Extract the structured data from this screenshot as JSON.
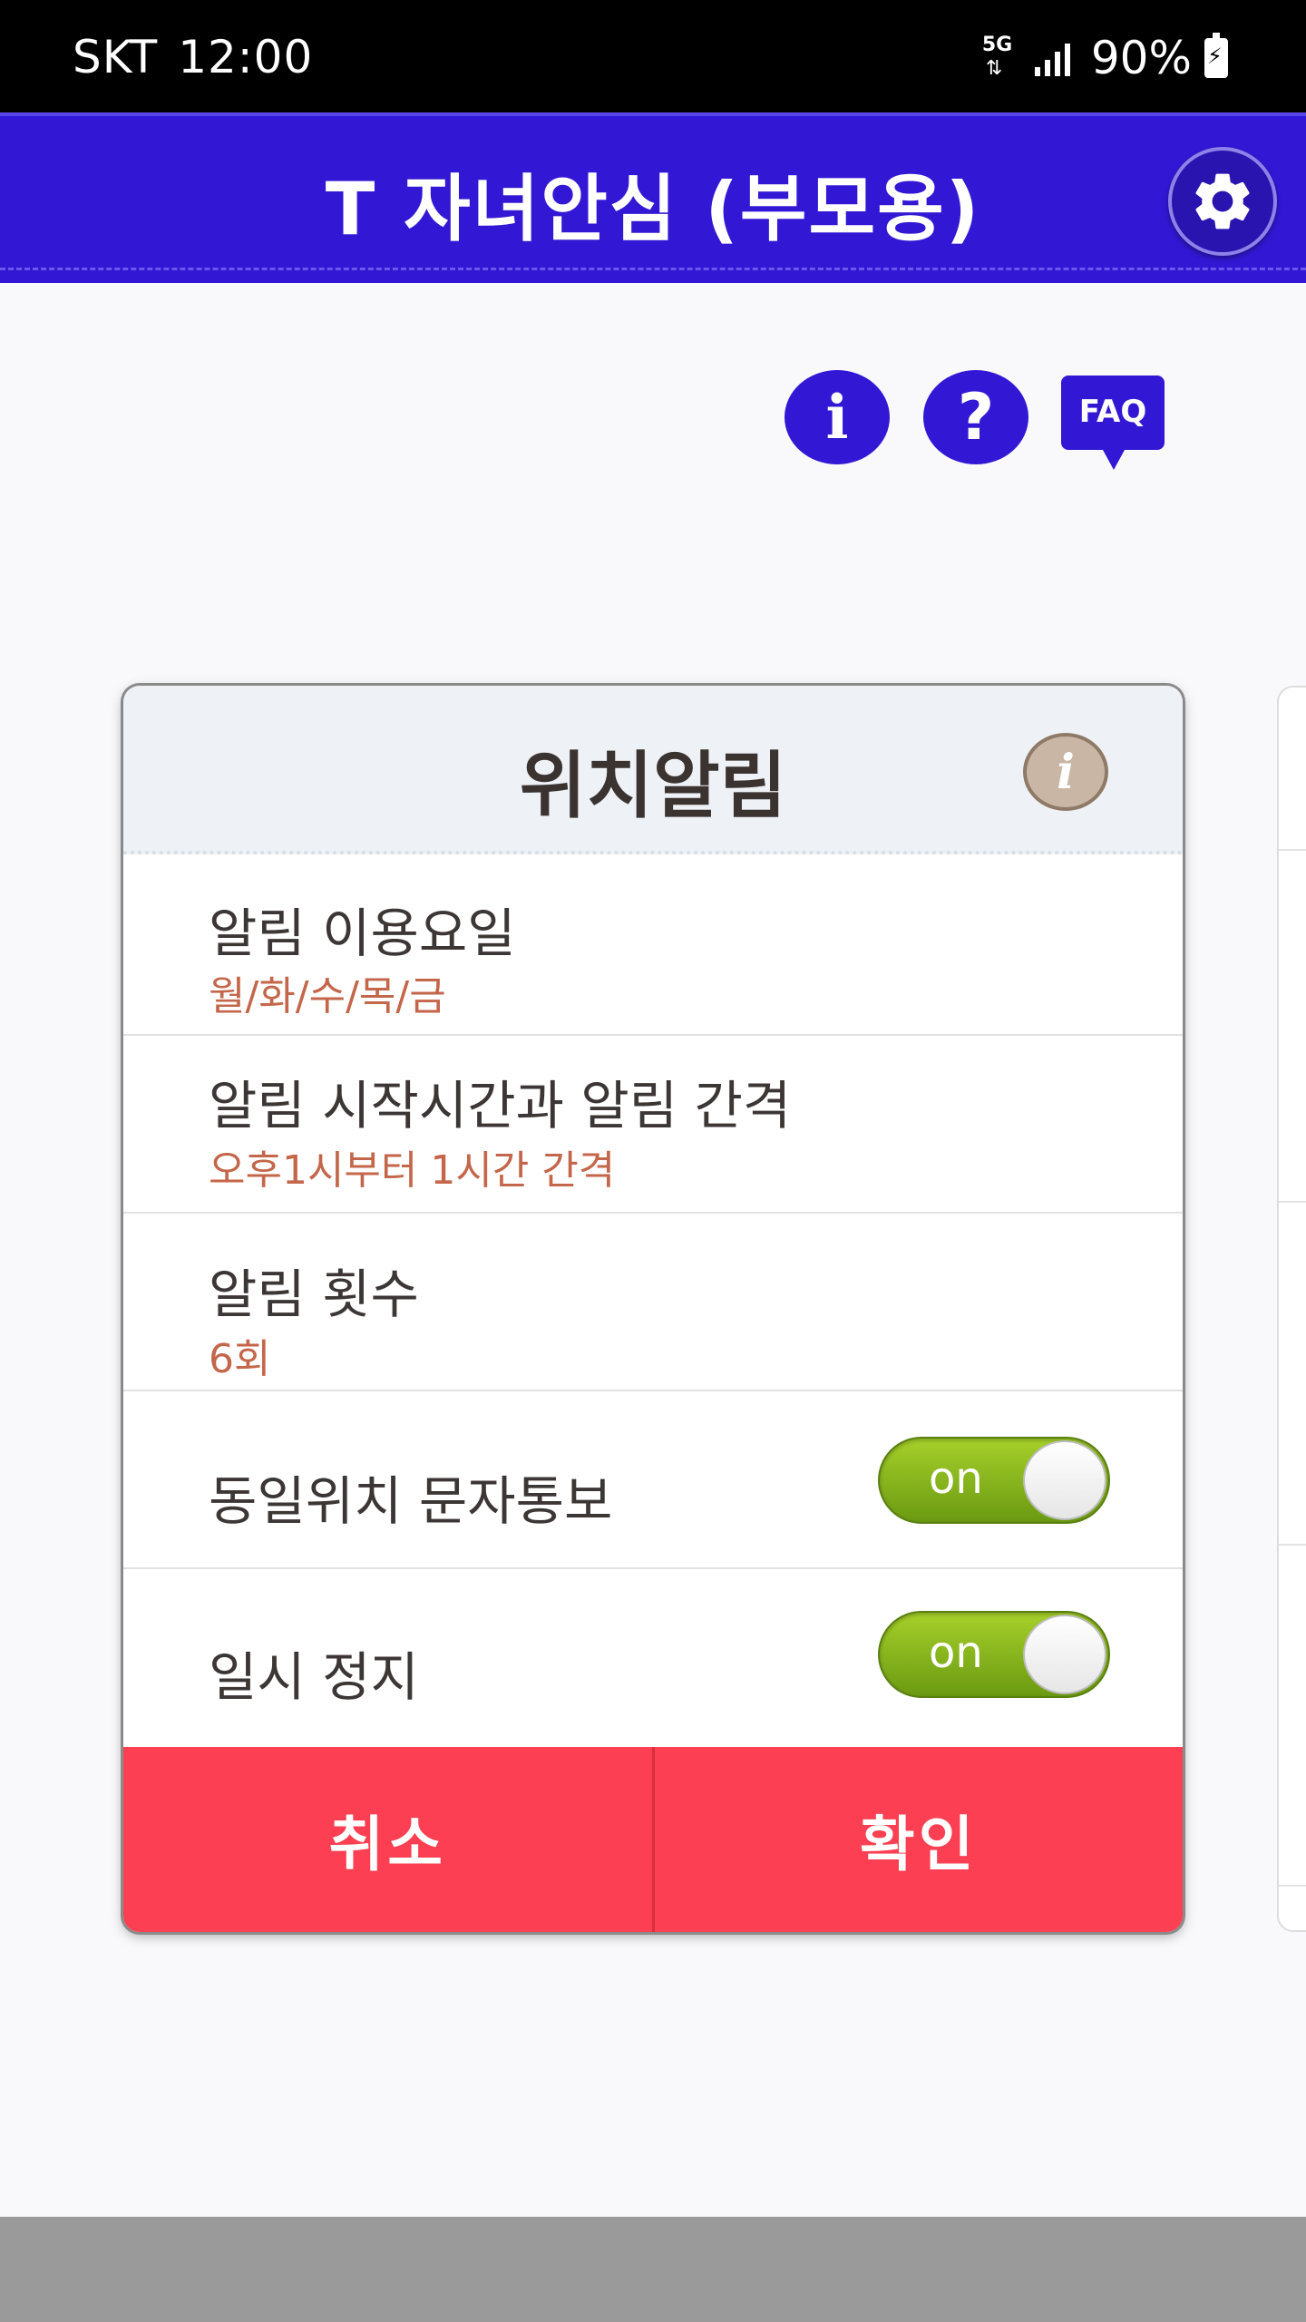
{
  "status_bar": {
    "carrier": "SKT",
    "time": "12:00",
    "network": "5G",
    "battery": "90%"
  },
  "header": {
    "title": "T 자녀안심 (부모용)"
  },
  "top_actions": {
    "info_glyph": "i",
    "help_glyph": "?",
    "faq_label": "FAQ"
  },
  "card": {
    "title": "위치알림",
    "info_glyph": "i",
    "rows": [
      {
        "title": "알림 이용요일",
        "value": "월/화/수/목/금"
      },
      {
        "title": "알림 시작시간과 알림 간격",
        "value": "오후1시부터 1시간 간격"
      },
      {
        "title": "알림 횟수",
        "value": "6회"
      }
    ],
    "toggles": [
      {
        "label": "동일위치 문자통보",
        "state": "on"
      },
      {
        "label": "일시 정지",
        "state": "on"
      }
    ],
    "cancel_label": "취소",
    "confirm_label": "확인"
  },
  "colors": {
    "header": "#3218d4",
    "value_text": "#c4664a",
    "button": "#fc3f52",
    "toggle_on": "#8cbb1f"
  }
}
